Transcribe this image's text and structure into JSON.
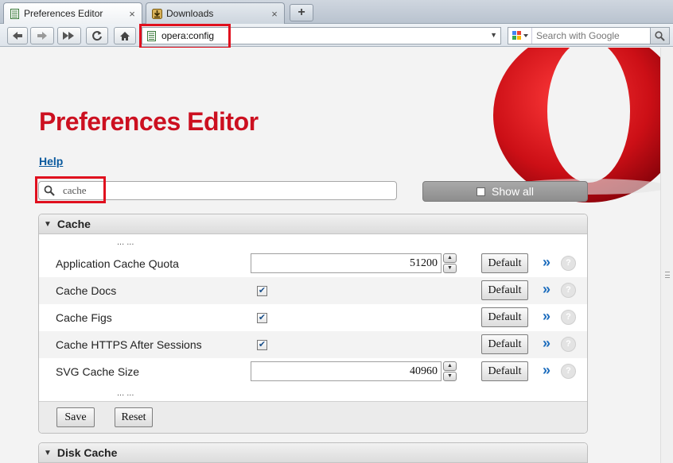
{
  "tabs": [
    {
      "label": "Preferences Editor",
      "close": "×"
    },
    {
      "label": "Downloads",
      "close": "×"
    }
  ],
  "new_tab": "+",
  "address": {
    "value": "opera:config"
  },
  "search": {
    "placeholder": "Search with Google",
    "engine_glyph": "g"
  },
  "page": {
    "title": "Preferences Editor",
    "help": "Help",
    "filter_value": "cache",
    "show_all": "Show all"
  },
  "sections": [
    {
      "title": "Cache",
      "ellipsis_top": "... ...",
      "ellipsis_bottom": "... ...",
      "rows": [
        {
          "label": "Application Cache Quota",
          "type": "number",
          "value": "51200"
        },
        {
          "label": "Cache Docs",
          "type": "checkbox",
          "checked": true
        },
        {
          "label": "Cache Figs",
          "type": "checkbox",
          "checked": true
        },
        {
          "label": "Cache HTTPS After Sessions",
          "type": "checkbox",
          "checked": true
        },
        {
          "label": "SVG Cache Size",
          "type": "number",
          "value": "40960"
        }
      ],
      "default_label": "Default",
      "more_glyph": "»",
      "help_glyph": "?",
      "save": "Save",
      "reset": "Reset"
    },
    {
      "title": "Disk Cache"
    }
  ],
  "colors": {
    "brand_red": "#cc1020",
    "highlight": "#e0101e",
    "link": "#0a5a9e"
  }
}
